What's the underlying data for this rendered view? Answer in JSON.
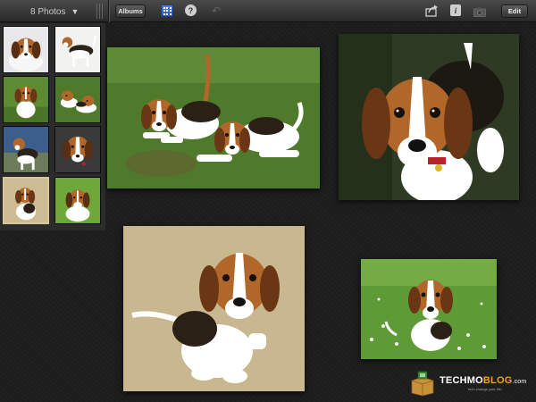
{
  "toolbar": {
    "photo_count": "8 Photos",
    "albums_label": "Albums",
    "edit_label": "Edit",
    "help_glyph": "?",
    "info_glyph": "i",
    "undo_glyph": "↶",
    "caret_glyph": "▼",
    "icons": [
      "chevron-down-icon",
      "grid-view-icon",
      "help-icon",
      "undo-icon",
      "share-icon",
      "info-icon",
      "camera-icon"
    ]
  },
  "thumbnails": {
    "count": 8,
    "selected_index": 6,
    "selected_border_color": "#d8c898"
  },
  "watermark": {
    "brand_a": "TECHMO",
    "brand_b": "BLOG",
    "brand_c": ".com",
    "tagline": "tech change your life..."
  },
  "colors": {
    "accent_blue": "#3a6fd0",
    "beagle_tan": "#b2672a",
    "grass_green": "#4f7a2c"
  }
}
